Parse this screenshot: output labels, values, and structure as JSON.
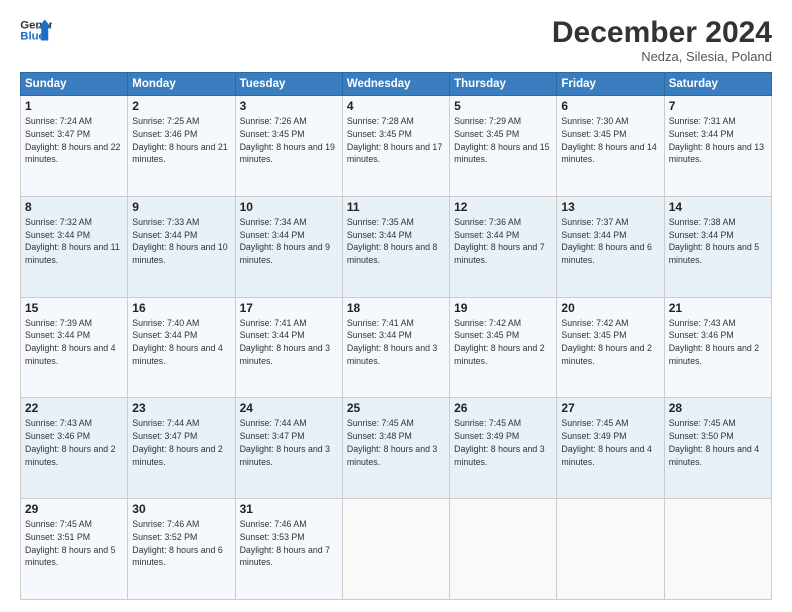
{
  "logo": {
    "line1": "General",
    "line2": "Blue"
  },
  "title": "December 2024",
  "location": "Nedza, Silesia, Poland",
  "days_of_week": [
    "Sunday",
    "Monday",
    "Tuesday",
    "Wednesday",
    "Thursday",
    "Friday",
    "Saturday"
  ],
  "weeks": [
    [
      {
        "num": "1",
        "rise": "7:24 AM",
        "set": "3:47 PM",
        "hours": "8 hours and 22 minutes."
      },
      {
        "num": "2",
        "rise": "7:25 AM",
        "set": "3:46 PM",
        "hours": "8 hours and 21 minutes."
      },
      {
        "num": "3",
        "rise": "7:26 AM",
        "set": "3:45 PM",
        "hours": "8 hours and 19 minutes."
      },
      {
        "num": "4",
        "rise": "7:28 AM",
        "set": "3:45 PM",
        "hours": "8 hours and 17 minutes."
      },
      {
        "num": "5",
        "rise": "7:29 AM",
        "set": "3:45 PM",
        "hours": "8 hours and 15 minutes."
      },
      {
        "num": "6",
        "rise": "7:30 AM",
        "set": "3:45 PM",
        "hours": "8 hours and 14 minutes."
      },
      {
        "num": "7",
        "rise": "7:31 AM",
        "set": "3:44 PM",
        "hours": "8 hours and 13 minutes."
      }
    ],
    [
      {
        "num": "8",
        "rise": "7:32 AM",
        "set": "3:44 PM",
        "hours": "8 hours and 11 minutes."
      },
      {
        "num": "9",
        "rise": "7:33 AM",
        "set": "3:44 PM",
        "hours": "8 hours and 10 minutes."
      },
      {
        "num": "10",
        "rise": "7:34 AM",
        "set": "3:44 PM",
        "hours": "8 hours and 9 minutes."
      },
      {
        "num": "11",
        "rise": "7:35 AM",
        "set": "3:44 PM",
        "hours": "8 hours and 8 minutes."
      },
      {
        "num": "12",
        "rise": "7:36 AM",
        "set": "3:44 PM",
        "hours": "8 hours and 7 minutes."
      },
      {
        "num": "13",
        "rise": "7:37 AM",
        "set": "3:44 PM",
        "hours": "8 hours and 6 minutes."
      },
      {
        "num": "14",
        "rise": "7:38 AM",
        "set": "3:44 PM",
        "hours": "8 hours and 5 minutes."
      }
    ],
    [
      {
        "num": "15",
        "rise": "7:39 AM",
        "set": "3:44 PM",
        "hours": "8 hours and 4 minutes."
      },
      {
        "num": "16",
        "rise": "7:40 AM",
        "set": "3:44 PM",
        "hours": "8 hours and 4 minutes."
      },
      {
        "num": "17",
        "rise": "7:41 AM",
        "set": "3:44 PM",
        "hours": "8 hours and 3 minutes."
      },
      {
        "num": "18",
        "rise": "7:41 AM",
        "set": "3:44 PM",
        "hours": "8 hours and 3 minutes."
      },
      {
        "num": "19",
        "rise": "7:42 AM",
        "set": "3:45 PM",
        "hours": "8 hours and 2 minutes."
      },
      {
        "num": "20",
        "rise": "7:42 AM",
        "set": "3:45 PM",
        "hours": "8 hours and 2 minutes."
      },
      {
        "num": "21",
        "rise": "7:43 AM",
        "set": "3:46 PM",
        "hours": "8 hours and 2 minutes."
      }
    ],
    [
      {
        "num": "22",
        "rise": "7:43 AM",
        "set": "3:46 PM",
        "hours": "8 hours and 2 minutes."
      },
      {
        "num": "23",
        "rise": "7:44 AM",
        "set": "3:47 PM",
        "hours": "8 hours and 2 minutes."
      },
      {
        "num": "24",
        "rise": "7:44 AM",
        "set": "3:47 PM",
        "hours": "8 hours and 3 minutes."
      },
      {
        "num": "25",
        "rise": "7:45 AM",
        "set": "3:48 PM",
        "hours": "8 hours and 3 minutes."
      },
      {
        "num": "26",
        "rise": "7:45 AM",
        "set": "3:49 PM",
        "hours": "8 hours and 3 minutes."
      },
      {
        "num": "27",
        "rise": "7:45 AM",
        "set": "3:49 PM",
        "hours": "8 hours and 4 minutes."
      },
      {
        "num": "28",
        "rise": "7:45 AM",
        "set": "3:50 PM",
        "hours": "8 hours and 4 minutes."
      }
    ],
    [
      {
        "num": "29",
        "rise": "7:45 AM",
        "set": "3:51 PM",
        "hours": "8 hours and 5 minutes."
      },
      {
        "num": "30",
        "rise": "7:46 AM",
        "set": "3:52 PM",
        "hours": "8 hours and 6 minutes."
      },
      {
        "num": "31",
        "rise": "7:46 AM",
        "set": "3:53 PM",
        "hours": "8 hours and 7 minutes."
      },
      null,
      null,
      null,
      null
    ]
  ],
  "labels": {
    "sunrise": "Sunrise:",
    "sunset": "Sunset:",
    "daylight": "Daylight:"
  }
}
